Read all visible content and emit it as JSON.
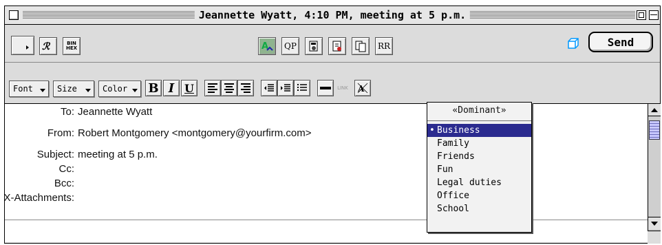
{
  "window": {
    "title": "Jeannette Wyatt, 4:10 PM, meeting at 5 p.m."
  },
  "toolbar": {
    "bin_hex_label": "BIN HEX",
    "qp_label": "QP",
    "rr_label": "RR",
    "send_label": "Send"
  },
  "format_bar": {
    "font_label": "Font",
    "size_label": "Size",
    "color_label": "Color",
    "bold_label": "B",
    "italic_label": "I",
    "underline_label": "U",
    "link_label": "LINK"
  },
  "headers": {
    "to_label": "To:",
    "to_value": "Jeannette Wyatt",
    "from_label": "From:",
    "from_value": "Robert Montgomery <montgomery@yourfirm.com>",
    "subject_label": "Subject:",
    "subject_value": "meeting at 5 p.m.",
    "cc_label": "Cc:",
    "cc_value": "",
    "bcc_label": "Bcc:",
    "bcc_value": "",
    "attachments_label": "X-Attachments:",
    "attachments_value": ""
  },
  "personality_menu": {
    "title": "«Dominant»",
    "items": [
      "Business",
      "Family",
      "Friends",
      "Fun",
      "Legal duties",
      "Office",
      "School"
    ],
    "selected": "Business"
  }
}
